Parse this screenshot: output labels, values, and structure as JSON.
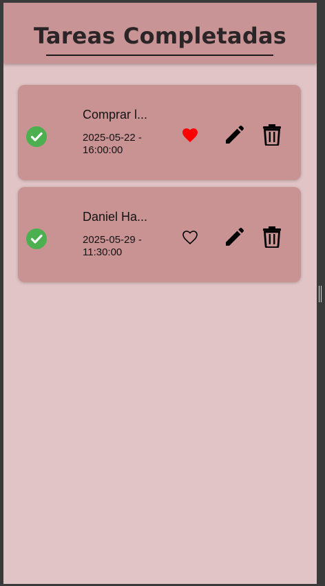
{
  "header": {
    "title": "Tareas Completadas"
  },
  "tasks": [
    {
      "title": "Comprar l...",
      "date_line1": "2025-05-22 -",
      "date_line2": "16:00:00",
      "completed": true,
      "favorite": true,
      "icons": {
        "status": "check-circle-icon",
        "favorite": "heart-filled-icon",
        "edit": "pencil-icon",
        "delete": "trash-icon"
      }
    },
    {
      "title": "Daniel Ha...",
      "date_line1": "2025-05-29 -",
      "date_line2": "11:30:00",
      "completed": true,
      "favorite": false,
      "icons": {
        "status": "check-circle-icon",
        "favorite": "heart-outline-icon",
        "edit": "pencil-icon",
        "delete": "trash-icon"
      }
    }
  ],
  "colors": {
    "background": "#e1c4c6",
    "appbar": "#c99495",
    "card": "#c99394",
    "check": "#4caf50",
    "favorite": "#ff0000"
  }
}
